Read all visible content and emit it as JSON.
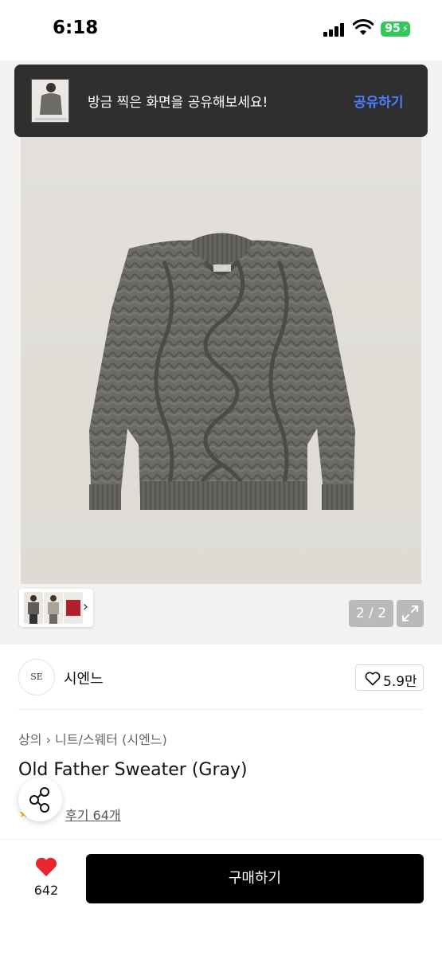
{
  "status_bar": {
    "time": "6:18",
    "battery": "95"
  },
  "toast": {
    "message": "방금 찍은 화면을 공유해보세요!",
    "action_label": "공유하기",
    "action_color": "#4a7dff"
  },
  "gallery": {
    "counter": "2 / 2",
    "current_index": 2,
    "total": 2
  },
  "brand": {
    "logo_text": "SE",
    "name": "시엔느",
    "likes": "5.9만"
  },
  "product": {
    "breadcrumb": [
      "상의",
      "니트/스웨터 (시엔느)"
    ],
    "title": "Old Father Sweater (Gray)",
    "review_label": "후기 64개"
  },
  "bottom_bar": {
    "like_count": "642",
    "buy_label": "구매하기"
  },
  "colors": {
    "heart": "#e8262f",
    "rating_star": "#f5b800",
    "sweater": "#6b6a68"
  }
}
